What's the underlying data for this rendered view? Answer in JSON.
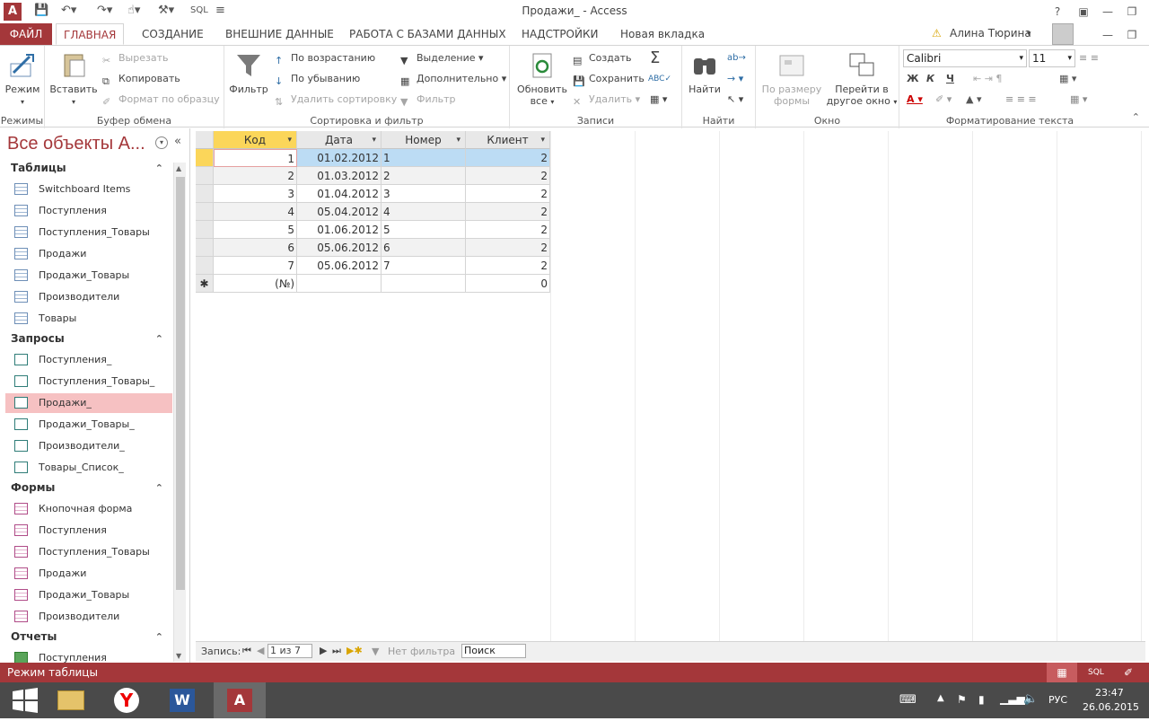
{
  "title": "Продажи_ - Access",
  "qat": {
    "sql": "SQL"
  },
  "window": {
    "help": "?"
  },
  "tabs": {
    "file": "ФАЙЛ",
    "home": "ГЛАВНАЯ",
    "create": "СОЗДАНИЕ",
    "external": "ВНЕШНИЕ ДАННЫЕ",
    "dbtools": "РАБОТА С БАЗАМИ ДАННЫХ",
    "addins": "НАДСТРОЙКИ",
    "newtab": "Новая вкладка"
  },
  "user": {
    "name": "Алина Тюрина"
  },
  "ribbon": {
    "views": {
      "view": "Режим",
      "group": "Режимы"
    },
    "clipboard": {
      "paste": "Вставить",
      "cut": "Вырезать",
      "copy": "Копировать",
      "format_painter": "Формат по образцу",
      "group": "Буфер обмена"
    },
    "sort": {
      "filter": "Фильтр",
      "ascending": "По возрастанию",
      "descending": "По убыванию",
      "remove_sort": "Удалить сортировку",
      "selection": "Выделение",
      "advanced": "Дополнительно",
      "toggle_filter": "Фильтр",
      "group": "Сортировка и фильтр"
    },
    "records": {
      "refresh": "Обновить",
      "refresh2": "все",
      "new": "Создать",
      "save": "Сохранить",
      "delete": "Удалить",
      "group": "Записи"
    },
    "find": {
      "find": "Найти",
      "group": "Найти"
    },
    "window": {
      "size": "По размеру",
      "size2": "формы",
      "switch": "Перейти в",
      "switch2": "другое окно",
      "group": "Окно"
    },
    "text": {
      "font": "Calibri",
      "size": "11",
      "bold": "Ж",
      "italic": "К",
      "underline": "Ч",
      "group": "Форматирование текста"
    }
  },
  "nav": {
    "title": "Все объекты A...",
    "tables_header": "Таблицы",
    "tables": [
      "Switchboard Items",
      "Поступления",
      "Поступления_Товары",
      "Продажи",
      "Продажи_Товары",
      "Производители",
      "Товары"
    ],
    "queries_header": "Запросы",
    "queries": [
      "Поступления_",
      "Поступления_Товары_",
      "Продажи_",
      "Продажи_Товары_",
      "Производители_",
      "Товары_Список_"
    ],
    "forms_header": "Формы",
    "forms": [
      "Кнопочная форма",
      "Поступления",
      "Поступления_Товары",
      "Продажи",
      "Продажи_Товары",
      "Производители"
    ],
    "reports_header": "Отчеты",
    "reports": [
      "Поступления"
    ]
  },
  "grid": {
    "columns": [
      "Код",
      "Дата",
      "Номер",
      "Клиент"
    ],
    "rows": [
      [
        "1",
        "01.02.2012",
        "1",
        "2"
      ],
      [
        "2",
        "01.03.2012",
        "2",
        "2"
      ],
      [
        "3",
        "01.04.2012",
        "3",
        "2"
      ],
      [
        "4",
        "05.04.2012",
        "4",
        "2"
      ],
      [
        "5",
        "01.06.2012",
        "5",
        "2"
      ],
      [
        "6",
        "05.06.2012",
        "6",
        "2"
      ],
      [
        "7",
        "05.06.2012",
        "7",
        "2"
      ]
    ],
    "new_row": [
      "(№)",
      "",
      "",
      "0"
    ]
  },
  "recnav": {
    "label": "Запись:",
    "current": "1 из 7",
    "filter": "Нет фильтра",
    "search": "Поиск"
  },
  "status": {
    "text": "Режим таблицы",
    "sql": "SQL"
  },
  "taskbar": {
    "lang": "РУС",
    "time": "23:47",
    "date": "26.06.2015"
  }
}
